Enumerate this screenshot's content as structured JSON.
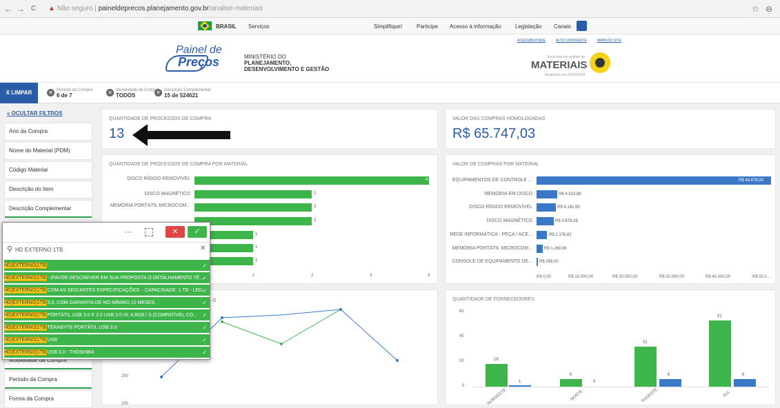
{
  "browser": {
    "back": "←",
    "forward": "→",
    "reload": "C",
    "warn": "Não seguro",
    "sep": "|",
    "host": "paineldeprecos.planejamento.gov.br",
    "path": "/analise-materiais",
    "star": "☆",
    "account": "⊖"
  },
  "govbar": {
    "brasil": "BRASIL",
    "servicos": "Serviços",
    "links": [
      "Simplifique!",
      "Participe",
      "Acesso à informação",
      "Legislação",
      "Canais"
    ]
  },
  "header": {
    "logo_line1": "Painel de",
    "logo_line2": "Preços",
    "ministry1": "MINISTÉRIO DO",
    "ministry2": "PLANEJAMENTO,",
    "ministry3": "DESENVOLVIMENTO E GESTÃO",
    "top_links": [
      "ACESSIBILIDADE",
      "ALTO CONTRASTE",
      "MAPA DO SITE"
    ],
    "analysis_caption": "Você está em análise de",
    "analysis_title": "MATERIAIS",
    "updated": "Atualizado em 23/10/2018"
  },
  "filters": {
    "clear": "X LIMPAR",
    "chips": [
      {
        "label": "Período da Compra",
        "value": "6 de 7"
      },
      {
        "label": "Modalidade da Compra",
        "value": "TODOS"
      },
      {
        "label": "Descrição Complementar",
        "value": "15 de 524621"
      }
    ]
  },
  "sidebar": {
    "hide": "« OCULTAR FILTROS",
    "items": [
      "Ano da Compra",
      "Nome do Material (PDM)",
      "Código Material",
      "Descrição do Item",
      "Descrição Complementar"
    ],
    "bottom_items": [
      "Modalidade da Compra",
      "Período da Compra",
      "Forma da Compra"
    ]
  },
  "kpi1": {
    "caption": "QUANTIDADE DE PROCESSOS DE COMPRA",
    "value": "13"
  },
  "kpi2": {
    "caption": "VALOR DAS COMPRAS HOMOLOGADAS",
    "value": "R$ 65.747,03"
  },
  "chart1": {
    "caption": "QUANTIDADE DE PROCESSOS DE COMPRA POR MATERIAL",
    "labels": [
      "DISCO RÍGIDO REMOVÍVEL",
      "DISCO MAGNÉTICO",
      "MEMÓRIA PORTÁTIL MICROCOM...",
      "REDE INFORMÁTICA - PEÇA / ACE..."
    ],
    "values": [
      "4",
      "2",
      "2",
      "2",
      "1",
      "1",
      "1"
    ],
    "ticks": [
      "1",
      "2",
      "3",
      "4"
    ]
  },
  "chart2": {
    "caption": "VALOR DE COMPRAS POR MATERIAL",
    "labels": [
      "EQUIPAMENTOS DE CONTROLE ...",
      "MEMÓRIA EM DISCO",
      "DISCO RÍGIDO REMOVÍVEL",
      "DISCO MAGNÉTICO",
      "REDE INFORMÁTICA - PEÇA / ACE...",
      "MEMÓRIA PORTÁTIL MICROCOM...",
      "CONSOLE DE EQUIPAMENTO DE..."
    ],
    "values": [
      "R$ 49.678,00",
      "R$ 4.523,88",
      "R$ 4.141,55",
      "R$ 3.678,28",
      "R$ 2.176,82",
      "R$ 1.269,86",
      "R$ 299,00"
    ],
    "ticks": [
      "R$ 0,00",
      "R$ 10.000,00",
      "R$ 20.000,00",
      "R$ 30.000,00",
      "R$ 40.000,00",
      "R$ 50.0..."
    ]
  },
  "chart3": {
    "caption_tail": "O",
    "ticks": [
      "250",
      "200"
    ]
  },
  "chart4": {
    "caption": "QUANTIDADE DE FORNECEDORES",
    "yticks": [
      "60",
      "40",
      "20",
      "0"
    ],
    "regions": [
      "NORDESTE",
      "NORTE",
      "SUDESTE",
      "SUL"
    ],
    "green": [
      "18",
      "6",
      "31",
      "51"
    ],
    "blue": [
      "1",
      "0",
      "6",
      "6"
    ]
  },
  "popup": {
    "search": "HD EXTERNO 1TB",
    "more": "···",
    "rows": [
      {
        "hd": "HD",
        "ext": "EXTERNO",
        "tb": "1TB",
        "rest": ""
      },
      {
        "hd": "HD",
        "ext": "EXTERNO",
        "tb": "1TB",
        "rest": " - (FAVOR DESCREVER EM SUA PROPOSTA O DETALHAMENTO TÉ..."
      },
      {
        "hd": "HD",
        "ext": "EXTERNO",
        "tb": "1TB",
        "rest": " COM AS SEGUINTES ESPECIFICAÇÕES: - CAPACIDADE: 1 TB - LED..."
      },
      {
        "hd": "HD",
        "ext": "EXTERNO",
        "tb": "1TB",
        "rest": " 3.0, COM GARANTIA DE NO MÍNIMO 12 MESES."
      },
      {
        "hd": "HD",
        "ext": "EXTERNO",
        "tb": "1TB",
        "rest": " PORTÁTIL USB 3.0 E 2.0 USB 3.0 Hi: 4.8GB / S (COMPATÍVEL CO..."
      },
      {
        "hd": "HD",
        "ext": "EXTERNO",
        "tb": "1TB",
        "rest": " TERABYTE PORTÁTIL USB 3.0"
      },
      {
        "hd": "HD",
        "ext": "EXTERNO",
        "tb": "1TB",
        "rest": " USB"
      },
      {
        "hd": "HD",
        "ext": "EXTERNO",
        "tb": "1TB",
        "rest": " USB 3.0 - THOSHIBA"
      }
    ]
  },
  "colors": {
    "green": "#3db54a",
    "blue": "#3b78c8",
    "accent": "#2a5ca8",
    "yellow": "#f7d117"
  }
}
